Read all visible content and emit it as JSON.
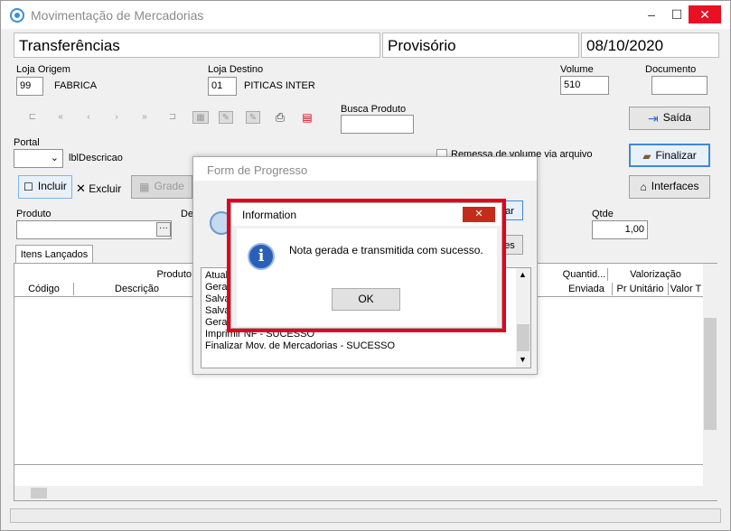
{
  "window": {
    "title": "Movimentação de Mercadorias",
    "minimize": "–",
    "maximize": "☐",
    "close": "✕"
  },
  "header": {
    "tipo": "Transferências",
    "status": "Provisório",
    "data": "08/10/2020"
  },
  "loja_origem": {
    "label": "Loja Origem",
    "code": "99",
    "name": "FABRICA"
  },
  "loja_destino": {
    "label": "Loja Destino",
    "code": "01",
    "name": "PITICAS INTER"
  },
  "volume": {
    "label": "Volume",
    "value": "510"
  },
  "documento": {
    "label": "Documento",
    "value": ""
  },
  "busca_produto": {
    "label": "Busca Produto",
    "value": ""
  },
  "buttons": {
    "saida": "Saída",
    "finalizar": "Finalizar",
    "interfaces": "Interfaces",
    "incluir": "Incluir",
    "excluir": "Excluir",
    "grade": "Grade"
  },
  "portal": {
    "label": "Portal",
    "desc": "lblDescricao"
  },
  "remessa": {
    "label": "Remessa de volume via arquivo"
  },
  "produto": {
    "label": "Produto",
    "value": "",
    "lookup": "···"
  },
  "qtde": {
    "label": "Qtde",
    "value": "1,00"
  },
  "tab": {
    "label": "Itens Lançados"
  },
  "grid": {
    "group_produto": "Produto",
    "group_quantidade": "Quantid...",
    "group_valorizacao": "Valorização",
    "col_codigo": "Código",
    "col_descricao": "Descrição",
    "col_enviada": "Enviada",
    "col_pr_unitario": "Pr Unitário",
    "col_valor": "Valor T"
  },
  "progress": {
    "title": "Form de Progresso",
    "lines": [
      "Atual",
      "Gerar",
      "Salva",
      "Salva",
      "Gerar",
      "Imprimir NF - SUCESSO",
      "Finalizar Mov. de Mercadorias - SUCESSO"
    ],
    "btn1": "ar",
    "btn2": "es"
  },
  "info": {
    "title": "Information",
    "message": "Nota gerada e transmitida com sucesso.",
    "ok": "OK",
    "close": "✕",
    "icon_letter": "i"
  },
  "colors": {
    "highlight_border": "#e3001b",
    "accent": "#3f87d6",
    "info_icon": "#2a5fb8"
  }
}
